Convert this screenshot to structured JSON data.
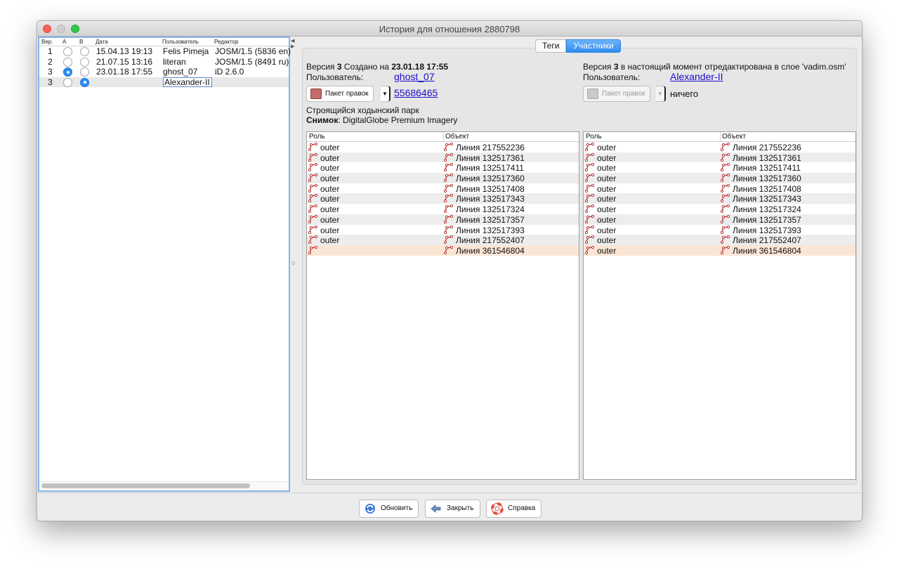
{
  "window": {
    "title": "История для отношения 2880798"
  },
  "versions_table": {
    "headers": [
      "Вер.",
      "A",
      "B",
      "Дата",
      "Пользователь",
      "Редактор"
    ],
    "rows": [
      {
        "version": "1",
        "a": false,
        "b": false,
        "date": "15.04.13 19:13",
        "user": "Felis Pimeja",
        "editor": "JOSM/1.5 (5836 en)"
      },
      {
        "version": "2",
        "a": false,
        "b": false,
        "date": "21.07.15 13:16",
        "user": "literan",
        "editor": "JOSM/1.5 (8491 ru)"
      },
      {
        "version": "3",
        "a": true,
        "b": false,
        "date": "23.01.18 17:55",
        "user": "ghost_07",
        "editor": "iD 2.6.0"
      },
      {
        "version": "3",
        "a": false,
        "b": true,
        "date": "",
        "user": "Alexander-II",
        "editor": ""
      }
    ]
  },
  "tabs": [
    {
      "label": "Теги"
    },
    {
      "label": "Участники"
    }
  ],
  "left_version": {
    "version_prefix": "Версия ",
    "version_number": "3",
    "created_prefix": " Создано на ",
    "created_datetime": "23.01.18 17:55",
    "user_label": "Пользователь:",
    "user_value": "ghost_07",
    "changeset_button": "Пакет правок",
    "changeset_id": "55686465",
    "comment": "Строящийся ходынский парк",
    "imagery_label": "Снимок",
    "imagery_value": ": DigitalGlobe Premium Imagery"
  },
  "right_version": {
    "version_prefix": "Версия ",
    "version_number": "3",
    "status_text": " в настоящий момент отредактирована в слое 'vadim.osm'",
    "user_label": "Пользователь:",
    "user_value": "Alexander-II",
    "changeset_button": "Пакет правок",
    "changeset_id": "ничего"
  },
  "members_headers": {
    "role": "Роль",
    "object": "Объект"
  },
  "left_members": [
    {
      "role": "outer",
      "object": "Линия 217552236"
    },
    {
      "role": "outer",
      "object": "Линия 132517361"
    },
    {
      "role": "outer",
      "object": "Линия 132517411"
    },
    {
      "role": "outer",
      "object": "Линия 132517360"
    },
    {
      "role": "outer",
      "object": "Линия 132517408"
    },
    {
      "role": "outer",
      "object": "Линия 132517343"
    },
    {
      "role": "outer",
      "object": "Линия 132517324"
    },
    {
      "role": "outer",
      "object": "Линия 132517357"
    },
    {
      "role": "outer",
      "object": "Линия 132517393"
    },
    {
      "role": "outer",
      "object": "Линия 217552407"
    },
    {
      "role": "",
      "object": "Линия 361546804",
      "diff": true
    }
  ],
  "right_members": [
    {
      "role": "outer",
      "object": "Линия 217552236"
    },
    {
      "role": "outer",
      "object": "Линия 132517361"
    },
    {
      "role": "outer",
      "object": "Линия 132517411"
    },
    {
      "role": "outer",
      "object": "Линия 132517360"
    },
    {
      "role": "outer",
      "object": "Линия 132517408"
    },
    {
      "role": "outer",
      "object": "Линия 132517343"
    },
    {
      "role": "outer",
      "object": "Линия 132517324"
    },
    {
      "role": "outer",
      "object": "Линия 132517357"
    },
    {
      "role": "outer",
      "object": "Линия 132517393"
    },
    {
      "role": "outer",
      "object": "Линия 217552407"
    },
    {
      "role": "outer",
      "object": "Линия 361546804",
      "diff": true
    }
  ],
  "buttons": {
    "refresh": "Обновить",
    "close": "Закрыть",
    "help": "Справка"
  },
  "icons": {
    "way": "way-icon",
    "refresh": "refresh-icon",
    "close": "close-icon",
    "help": "help-lifebuoy-icon"
  },
  "colors": {
    "accent": "#2f8cf0",
    "diff_row": "#fbe6d6",
    "link": "#1a0dcc"
  }
}
